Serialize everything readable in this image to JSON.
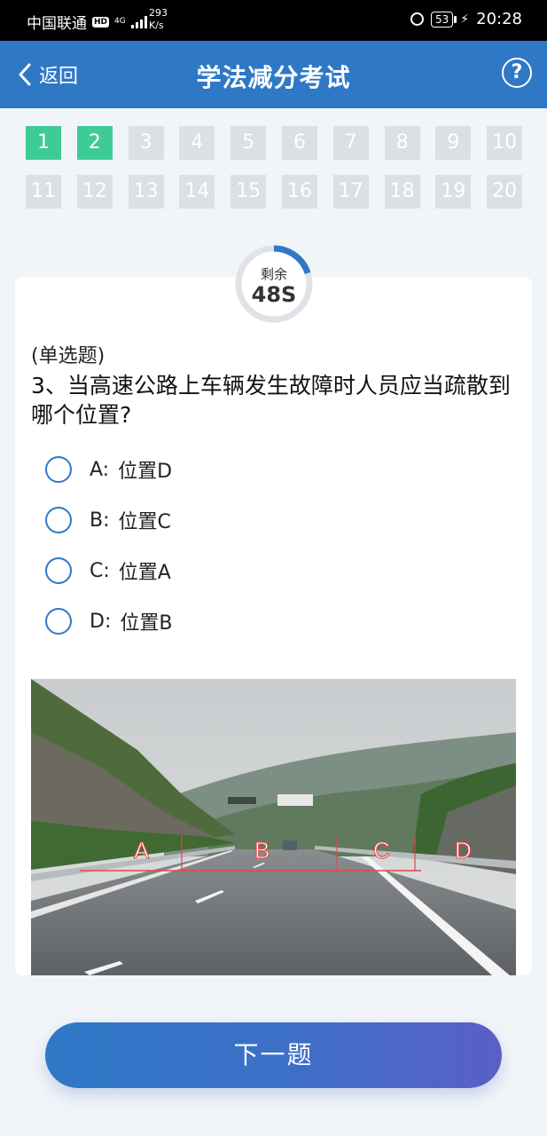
{
  "status_bar": {
    "carrier": "中国联通",
    "hd_badge": "HD",
    "network": "4G",
    "speed_value": "293",
    "speed_unit": "K/s",
    "battery": "53",
    "time": "20:28"
  },
  "header": {
    "back_label": "返回",
    "title": "学法减分考试",
    "help_symbol": "?"
  },
  "question_nav": [
    {
      "number": "1",
      "state": "answered"
    },
    {
      "number": "2",
      "state": "answered"
    },
    {
      "number": "3",
      "state": "pending"
    },
    {
      "number": "4",
      "state": "pending"
    },
    {
      "number": "5",
      "state": "pending"
    },
    {
      "number": "6",
      "state": "pending"
    },
    {
      "number": "7",
      "state": "pending"
    },
    {
      "number": "8",
      "state": "pending"
    },
    {
      "number": "9",
      "state": "pending"
    },
    {
      "number": "10",
      "state": "pending"
    },
    {
      "number": "11",
      "state": "pending"
    },
    {
      "number": "12",
      "state": "pending"
    },
    {
      "number": "13",
      "state": "pending"
    },
    {
      "number": "14",
      "state": "pending"
    },
    {
      "number": "15",
      "state": "pending"
    },
    {
      "number": "16",
      "state": "pending"
    },
    {
      "number": "17",
      "state": "pending"
    },
    {
      "number": "18",
      "state": "pending"
    },
    {
      "number": "19",
      "state": "pending"
    },
    {
      "number": "20",
      "state": "pending"
    }
  ],
  "timer": {
    "label": "剩余",
    "value": "48S",
    "remaining_fraction": 0.2
  },
  "question": {
    "type": "(单选题)",
    "text": "3、当高速公路上车辆发生故障时人员应当疏散到哪个位置?",
    "options": [
      {
        "letter": "A:",
        "text": "位置D"
      },
      {
        "letter": "B:",
        "text": "位置C"
      },
      {
        "letter": "C:",
        "text": "位置A"
      },
      {
        "letter": "D:",
        "text": "位置B"
      }
    ]
  },
  "photo_markers": [
    "A",
    "B",
    "C",
    "D"
  ],
  "next_button": "下一题",
  "colors": {
    "primary": "#2e78c6",
    "answered": "#3fcb95",
    "pending": "#dcdfe3",
    "marker": "#e04848"
  }
}
